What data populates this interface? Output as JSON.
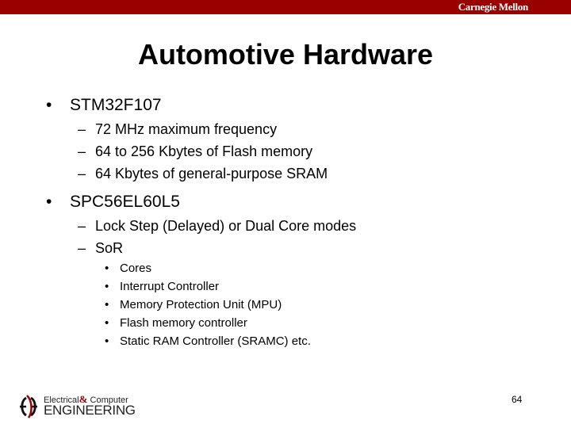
{
  "header": {
    "brand": "Carnegie Mellon",
    "bar_color": "#990000"
  },
  "slide": {
    "title": "Automotive Hardware",
    "bullets": [
      {
        "text": "STM32F107",
        "subitems": [
          {
            "text": "72 MHz maximum frequency"
          },
          {
            "text": "64 to 256 Kbytes of Flash memory"
          },
          {
            "text": "64 Kbytes of general-purpose SRAM"
          }
        ]
      },
      {
        "text": "SPC56EL60L5",
        "subitems": [
          {
            "text": "Lock Step (Delayed) or Dual Core modes"
          },
          {
            "text": "SoR",
            "subitems": [
              "Cores",
              "Interrupt Controller",
              "Memory Protection Unit (MPU)",
              "Flash memory controller",
              "Static RAM Controller (SRAMC) etc."
            ]
          }
        ]
      }
    ],
    "bullet_glyph": "•",
    "dash_glyph": "–"
  },
  "footer": {
    "logo_line1_a": "Electrical",
    "logo_amp": "&",
    "logo_line1_b": " Computer",
    "logo_line2": "ENGINEERING",
    "logo_icon": "ece-logo-icon",
    "page_number": "64"
  }
}
